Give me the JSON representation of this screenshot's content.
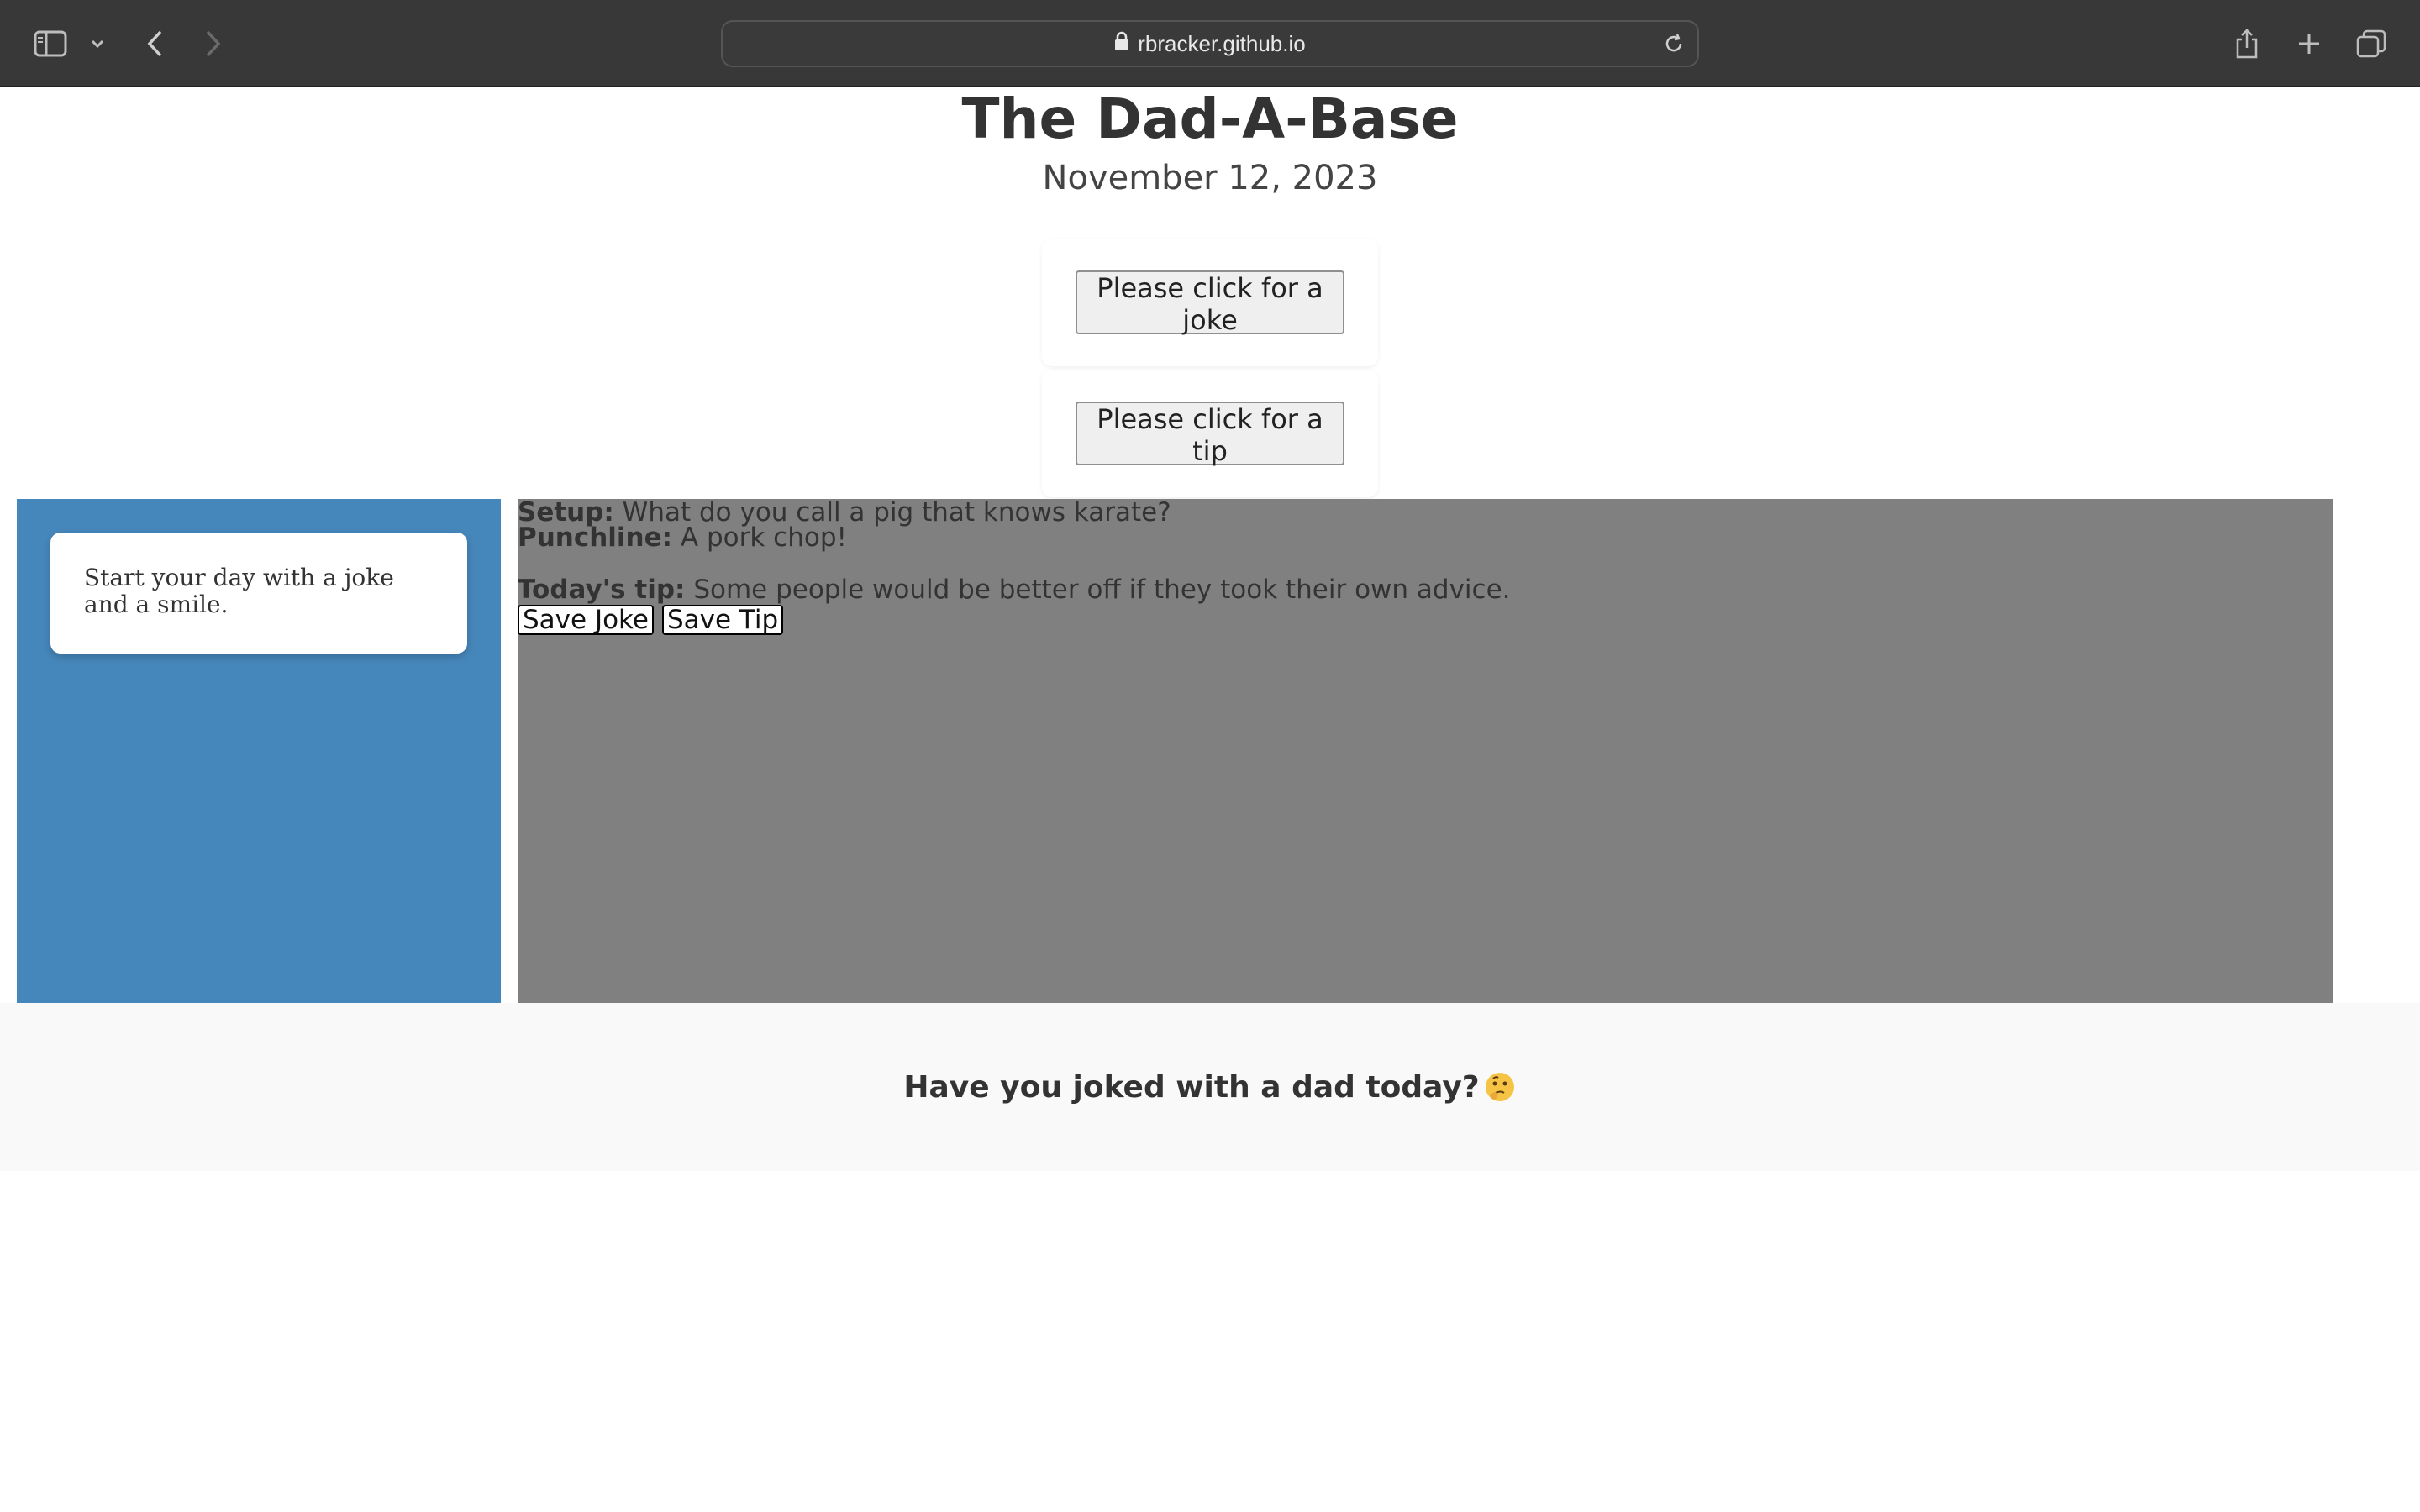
{
  "browser": {
    "url": "rbracker.github.io"
  },
  "header": {
    "title": "The Dad-A-Base",
    "date": "November 12, 2023"
  },
  "buttons": {
    "joke_label": "Please click for a joke",
    "tip_label": "Please click for a tip"
  },
  "sidebar": {
    "message": "Start your day with a joke and a smile."
  },
  "content": {
    "setup_label": "Setup:",
    "setup_text": " What do you call a pig that knows karate?",
    "punchline_label": "Punchline:",
    "punchline_text": " A pork chop!",
    "tip_label": "Today's tip:",
    "tip_text": " Some people would be better off if they took their own advice.",
    "save_joke_label": "Save Joke",
    "save_tip_label": "Save Tip"
  },
  "footer": {
    "text": "Have you joked with a dad today?"
  },
  "colors": {
    "sidebar_bg": "#4687bb",
    "content_bg": "#808080",
    "footer_bg": "#f9f9f9",
    "chrome_bg": "#383838"
  },
  "icons": [
    "sidebar-toggle-icon",
    "chevron-down-icon",
    "back-icon",
    "forward-icon",
    "lock-icon",
    "reload-icon",
    "share-icon",
    "new-tab-icon",
    "tabs-overview-icon",
    "thinking-face-emoji"
  ]
}
